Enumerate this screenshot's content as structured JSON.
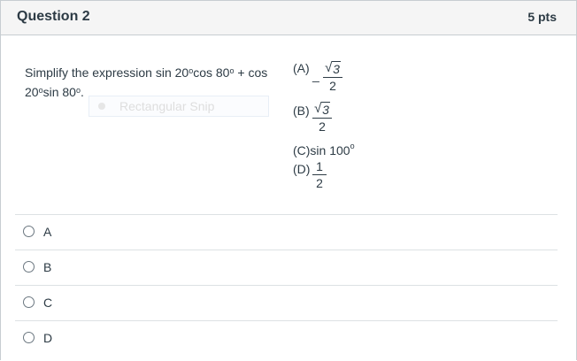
{
  "question": {
    "title": "Question 2",
    "points": "5 pts"
  },
  "prompt": {
    "line1": "Simplify the expression sin 20",
    "deg": "o",
    "line1b": "cos 80",
    "line1c": " + cos",
    "line2a": "20",
    "line2b": "sin 80",
    "line2c": "."
  },
  "overlay": {
    "snip_label": "Rectangular Snip",
    "dot_icon": "radio-dot-icon"
  },
  "choices": {
    "a_label": "(A)",
    "a_sign": "_",
    "a_radicand": "3",
    "a_den": "2",
    "b_label": "(B)",
    "b_radicand": "3",
    "b_den": "2",
    "c_label": "(C)sin 100",
    "c_deg": "o",
    "d_label": "(D)",
    "d_num": "1",
    "d_den": "2"
  },
  "answers": [
    {
      "label": "A"
    },
    {
      "label": "B"
    },
    {
      "label": "C"
    },
    {
      "label": "D"
    }
  ]
}
